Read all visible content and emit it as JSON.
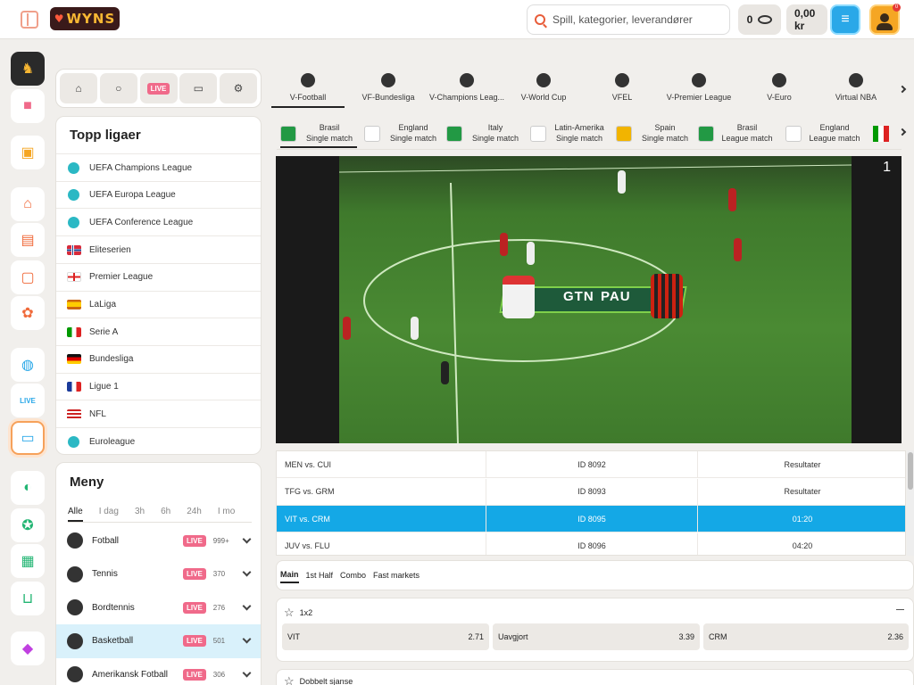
{
  "header": {
    "logo_text": "WYNS",
    "search_placeholder": "Spill, kategorier, leverandører",
    "coins": "0",
    "balance": "0,00 kr",
    "notification_count": "0"
  },
  "quick_nav": {
    "live_label": "LIVE"
  },
  "leagues": {
    "title": "Topp ligaer",
    "items": [
      {
        "name": "UEFA Champions League",
        "flag": "globe"
      },
      {
        "name": "UEFA Europa League",
        "flag": "globe"
      },
      {
        "name": "UEFA Conference League",
        "flag": "globe"
      },
      {
        "name": "Eliteserien",
        "flag": "norway"
      },
      {
        "name": "Premier League",
        "flag": "england"
      },
      {
        "name": "LaLiga",
        "flag": "spain"
      },
      {
        "name": "Serie A",
        "flag": "italy"
      },
      {
        "name": "Bundesliga",
        "flag": "germany"
      },
      {
        "name": "Ligue 1",
        "flag": "france"
      },
      {
        "name": "NFL",
        "flag": "usa"
      },
      {
        "name": "Euroleague",
        "flag": "globe"
      }
    ]
  },
  "menu": {
    "title": "Meny",
    "tabs": [
      "Alle",
      "I dag",
      "3h",
      "6h",
      "24h",
      "I mo"
    ],
    "live_label": "LIVE",
    "sports": [
      {
        "name": "Fotball",
        "count": "999+"
      },
      {
        "name": "Tennis",
        "count": "370"
      },
      {
        "name": "Bordtennis",
        "count": "276"
      },
      {
        "name": "Basketball",
        "count": "501"
      },
      {
        "name": "Amerikansk Fotball",
        "count": "306"
      }
    ]
  },
  "categories": [
    "V-Football",
    "VF-Bundesliga",
    "V-Champions Leag...",
    "V-World Cup",
    "VFEL",
    "V-Premier League",
    "V-Euro",
    "Virtual NBA"
  ],
  "subcategories": [
    {
      "line1": "Brasil",
      "line2": "Single match"
    },
    {
      "line1": "England",
      "line2": "Single match"
    },
    {
      "line1": "Italy",
      "line2": "Single match"
    },
    {
      "line1": "Latin-Amerika",
      "line2": "Single match"
    },
    {
      "line1": "Spain",
      "line2": "Single match"
    },
    {
      "line1": "Brasil",
      "line2": "League match"
    },
    {
      "line1": "England",
      "line2": "League match"
    }
  ],
  "video": {
    "home": "GTN",
    "away": "PAU",
    "counter": "1"
  },
  "matches": [
    {
      "teams": "MEN vs. CUI",
      "id": "ID 8092",
      "status": "Resultater"
    },
    {
      "teams": "TFG vs. GRM",
      "id": "ID 8093",
      "status": "Resultater"
    },
    {
      "teams": "VIT vs. CRM",
      "id": "ID 8095",
      "status": "01:20"
    },
    {
      "teams": "JUV vs. FLU",
      "id": "ID 8096",
      "status": "04:20"
    }
  ],
  "market_tabs": [
    "Main",
    "1st Half",
    "Combo",
    "Fast markets"
  ],
  "markets": {
    "m1": {
      "title": "1x2",
      "odds": [
        {
          "label": "VIT",
          "value": "2.71"
        },
        {
          "label": "Uavgjort",
          "value": "3.39"
        },
        {
          "label": "CRM",
          "value": "2.36"
        }
      ]
    },
    "m2": {
      "title": "Dobbelt sjanse"
    }
  },
  "colors": {
    "accent": "#14a8e6",
    "live": "#f06a8a",
    "brand": "#f7b733"
  }
}
